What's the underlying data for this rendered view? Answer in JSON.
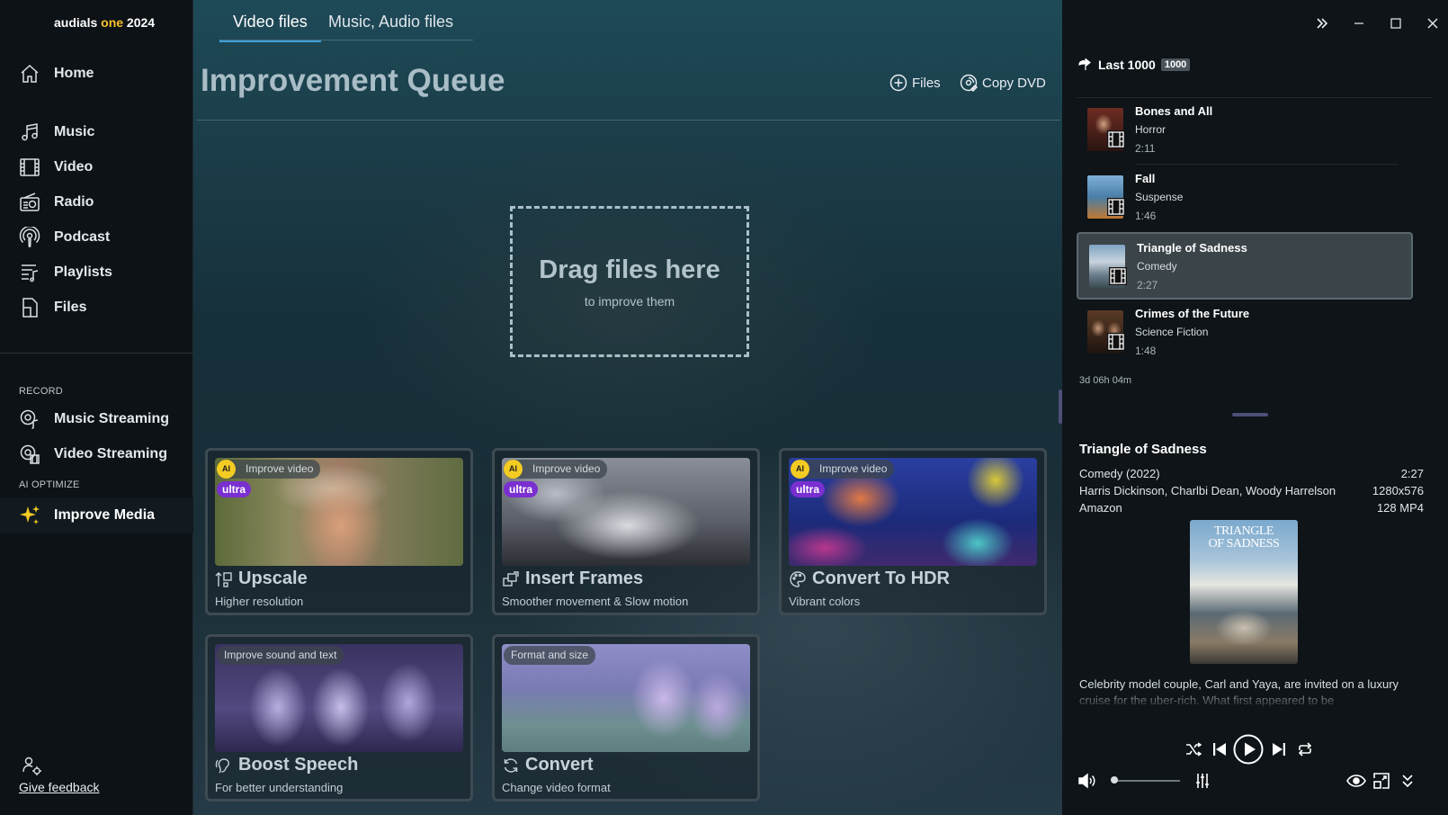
{
  "app": {
    "brand_prefix": "audials ",
    "brand_accent": "one",
    "brand_suffix": " 2024"
  },
  "sidebar": {
    "home": "Home",
    "items": [
      {
        "label": "Music",
        "icon": "music-note-icon"
      },
      {
        "label": "Video",
        "icon": "film-icon"
      },
      {
        "label": "Radio",
        "icon": "radio-icon"
      },
      {
        "label": "Podcast",
        "icon": "podcast-icon"
      },
      {
        "label": "Playlists",
        "icon": "playlist-icon"
      },
      {
        "label": "Files",
        "icon": "file-icon"
      }
    ],
    "record_label": "RECORD",
    "record_items": [
      {
        "label": "Music Streaming",
        "icon": "music-streaming-icon"
      },
      {
        "label": "Video Streaming",
        "icon": "video-streaming-icon"
      }
    ],
    "ai_label": "AI OPTIMIZE",
    "ai_item": "Improve Media",
    "feedback": "Give feedback"
  },
  "main": {
    "tabs": [
      {
        "label": "Video files",
        "active": true
      },
      {
        "label": "Music, Audio files",
        "active": false
      }
    ],
    "title": "Improvement Queue",
    "files_btn": "Files",
    "copy_dvd_btn": "Copy DVD",
    "drop_title": "Drag files here",
    "drop_sub": "to improve them",
    "cards": [
      {
        "badge": "Improve video",
        "ai": "AI",
        "ultra": "ultra",
        "title": "Upscale",
        "subtitle": "Higher resolution",
        "icon": "upscale-icon"
      },
      {
        "badge": "Improve video",
        "ai": "AI",
        "ultra": "ultra",
        "title": "Insert Frames",
        "subtitle": "Smoother movement & Slow motion",
        "icon": "frames-icon"
      },
      {
        "badge": "Improve video",
        "ai": "AI",
        "ultra": "ultra",
        "title": "Convert To HDR",
        "subtitle": "Vibrant colors",
        "icon": "palette-icon"
      },
      {
        "badge": "Improve sound and text",
        "title": "Boost Speech",
        "subtitle": "For better understanding",
        "icon": "speech-icon"
      },
      {
        "badge": "Format and size",
        "title": "Convert",
        "subtitle": "Change video format",
        "icon": "convert-icon"
      }
    ]
  },
  "right": {
    "list_title": "Last 1000",
    "list_count": "1000",
    "items": [
      {
        "title": "Bones and All",
        "genre": "Horror",
        "duration": "2:11"
      },
      {
        "title": "Fall",
        "genre": "Suspense",
        "duration": "1:46"
      },
      {
        "title": "Triangle of Sadness",
        "genre": "Comedy",
        "duration": "2:27",
        "selected": true
      },
      {
        "title": "Crimes of the Future",
        "genre": "Science Fiction",
        "duration": "1:48"
      }
    ],
    "total": "3d 06h 04m",
    "detail": {
      "title": "Triangle of Sadness",
      "genre_year": "Comedy (2022)",
      "duration": "2:27",
      "cast": "Harris Dickinson, Charlbi Dean, Woody Harrelson",
      "resolution": "1280x576",
      "source": "Amazon",
      "format": "128 MP4",
      "poster_line1": "TRIANGLE",
      "poster_line2": "OF SADNESS",
      "description": "Celebrity model couple, Carl and Yaya, are invited on a luxury cruise for the uber-rich. What first appeared to be"
    }
  },
  "colors": {
    "accent_blue": "#3aa0d8",
    "brand_yellow": "#f6c12b",
    "ultra_purple": "#7a2fd0",
    "ai_yellow": "#f3cb23"
  }
}
